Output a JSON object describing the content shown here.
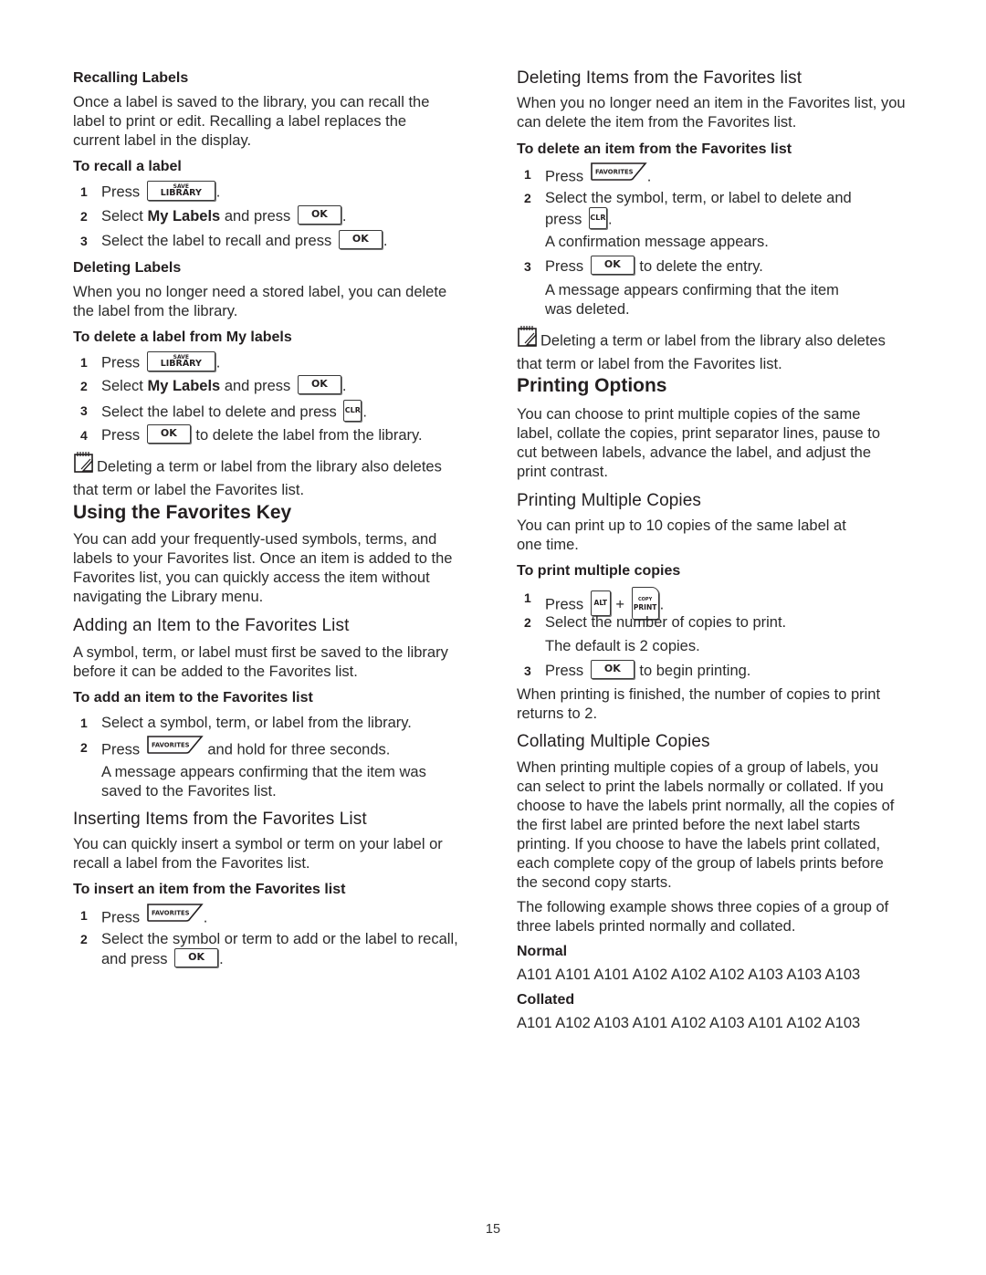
{
  "left": {
    "recalling": {
      "heading": "Recalling Labels",
      "body": [
        "Once a label is saved to the library, you can recall the",
        "label to print or edit. Recalling a label replaces the",
        "current label in the display."
      ],
      "proc_heading": "To recall a label",
      "steps": [
        {
          "num": "1",
          "pre": "Press",
          "key": "save-library",
          "post": "."
        },
        {
          "num": "2",
          "pre": "Select",
          "bold": "My Labels",
          "mid": "and press",
          "key": "ok",
          "post": "."
        },
        {
          "num": "3",
          "pre": "Select the label to recall and press",
          "key": "ok",
          "post": "."
        }
      ]
    },
    "deleting": {
      "heading": "Deleting Labels",
      "body": [
        "When you no longer need a stored label, you can delete",
        "the label from the library."
      ],
      "proc_heading": "To delete a label from My labels",
      "steps": [
        {
          "num": "1",
          "pre": "Press",
          "key": "save-library",
          "post": "."
        },
        {
          "num": "2",
          "pre": "Select",
          "bold": "My Labels",
          "mid": "and press",
          "key": "ok",
          "post": "."
        },
        {
          "num": "3",
          "pre": "Select the label to delete and press",
          "key": "clr",
          "post": "."
        },
        {
          "num": "4",
          "pre": "Press",
          "key": "ok",
          "post": "to delete the label from the library."
        }
      ],
      "note": [
        "Deleting a term or label from the library also deletes",
        "that term or label the Favorites list."
      ]
    },
    "favorites_key": {
      "heading": "Using the Favorites Key",
      "body": [
        "You can add your frequently-used symbols, terms, and",
        "labels to your Favorites list. Once an item is added to the",
        "Favorites list, you can quickly access the item without",
        "navigating the Library menu."
      ]
    },
    "adding": {
      "heading": "Adding an Item to the Favorites List",
      "body": [
        "A symbol, term, or label must first be saved to the library",
        "before it can be added to the Favorites list."
      ],
      "proc_heading": "To add an item to the Favorites list",
      "steps": [
        {
          "num": "1",
          "text": "Select a symbol, term, or label from the library."
        },
        {
          "num": "2",
          "pre": "Press",
          "key": "favorites",
          "post": "and hold for three seconds."
        }
      ],
      "result": [
        "A message appears confirming that the item was",
        "saved to the Favorites list."
      ]
    },
    "inserting": {
      "heading": "Inserting Items from the Favorites List",
      "body": [
        "You can quickly insert a symbol or term on your label or",
        "recall a label from the Favorites list."
      ],
      "proc_heading": "To insert an item from the Favorites list",
      "steps": [
        {
          "num": "1",
          "pre": "Press",
          "key": "favorites",
          "post": "."
        },
        {
          "num": "2",
          "line1": "Select the symbol or term to add or the label to recall,",
          "pre": "and press",
          "key": "ok",
          "post": "."
        }
      ]
    }
  },
  "right": {
    "deleting_fav": {
      "heading": "Deleting Items from the Favorites list",
      "body": [
        "When you no longer need an item in the Favorites list, you",
        "can delete the item from the Favorites list."
      ],
      "proc_heading": "To delete an item from the Favorites list",
      "steps": [
        {
          "num": "1",
          "pre": "Press",
          "key": "favorites",
          "post": "."
        },
        {
          "num": "2",
          "line1": "Select the symbol, term, or label to delete and",
          "pre": "press",
          "key": "clr",
          "post": "."
        },
        {
          "num": "3",
          "pre": "Press",
          "key": "ok",
          "post": "to delete the entry."
        }
      ],
      "result_after_2": "A confirmation message appears.",
      "result_after_3": [
        "A message appears confirming that the item",
        "was deleted."
      ],
      "note": [
        "Deleting a term or label from the library also deletes",
        "that term or label from the Favorites list."
      ]
    },
    "printing_options": {
      "heading": "Printing Options",
      "body": [
        "You can choose to print multiple copies of the same",
        "label, collate the copies, print separator lines, pause to",
        "cut between labels, advance the label, and adjust the",
        "print contrast."
      ]
    },
    "multiple_copies": {
      "heading": "Printing Multiple Copies",
      "body": [
        "You can print up to 10 copies of the same label at",
        "one time."
      ],
      "proc_heading": "To print multiple copies",
      "steps": [
        {
          "num": "1",
          "pre": "Press",
          "key": "alt",
          "plus": "+",
          "key2": "copy-print",
          "post": "."
        },
        {
          "num": "2",
          "text": "Select the number of copies to print."
        },
        {
          "num": "3",
          "pre": "Press",
          "key": "ok",
          "post": "to begin printing."
        }
      ],
      "result_after_2": "The default is 2 copies.",
      "after": [
        "When printing is finished, the number of copies to print",
        "returns to 2."
      ]
    },
    "collating": {
      "heading": "Collating Multiple Copies",
      "body": [
        "When printing multiple copies of a group of labels, you",
        "can select to print the labels normally or collated. If you",
        "choose to have the labels print normally, all the copies of",
        "the first label are printed before the next label starts",
        "printing. If you choose to have the labels print collated,",
        "each complete copy of the group of labels prints before",
        "the second copy starts."
      ],
      "body2": [
        "The following example shows three copies of a group of",
        "three labels printed normally and collated."
      ],
      "normal_label": "Normal",
      "normal_sequence": "A101 A101 A101 A102 A102 A102 A103 A103 A103",
      "collated_label": "Collated",
      "collated_sequence": "A101 A102 A103 A101 A102 A103 A101 A102 A103"
    }
  },
  "keys": {
    "ok": "OK",
    "save_small": "SAVE",
    "library": "LIBRARY",
    "clr": "CLR",
    "favorites": "FAVORITES",
    "alt": "ALT",
    "copy_small": "COPY",
    "print": "PRINT"
  },
  "page_number": "15"
}
